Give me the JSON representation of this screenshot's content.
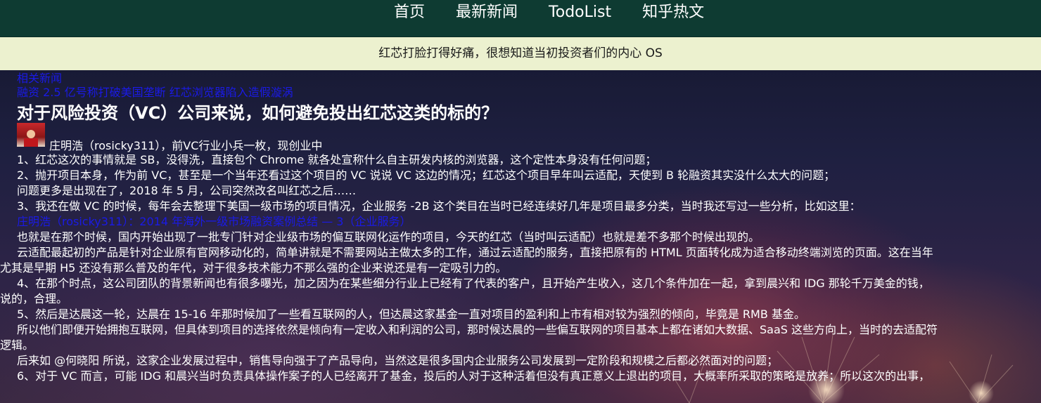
{
  "nav": {
    "items": [
      {
        "label": "首页"
      },
      {
        "label": "最新新闻"
      },
      {
        "label": "TodoList"
      },
      {
        "label": "知乎热文"
      }
    ]
  },
  "banner": {
    "text": "红芯打脸打得好痛，很想知道当初投资者们的内心 OS"
  },
  "related": {
    "header": "相关新闻",
    "link": "融资 2.5 亿号称打破美国垄断 红芯浏览器陷入造假漩涡"
  },
  "question": {
    "title": "对于风险投资（VC）公司来说，如何避免投出红芯这类的标的？"
  },
  "answer": {
    "author": "庄明浩（rosicky311），前VC行业小兵一枚，现创业中",
    "lines": [
      "1、红芯这次的事情就是 SB，没得洗，直接包个 Chrome 就各处宣称什么自主研发内核的浏览器，这个定性本身没有任何问题；",
      "2、抛开项目本身，作为前 VC，甚至是一个当年还看过这个项目的 VC 说说 VC 这边的情况；红芯这个项目早年叫云适配，天使到 B 轮融资其实没什么太大的问题；",
      "问题更多是出现在了，2018 年 5 月，公司突然改名叫红芯之后……",
      "3、我还在做 VC 的时候，每年会去整理下美国一级市场的项目情况，企业服务 -2B 这个类目在当时已经连续好几年是项目最多分类，当时我还写过一些分析，比如这里："
    ],
    "inline_link": "庄明浩（rosicky311）：2014 年海外一级市场融资案例总结 — 3（企业服务）",
    "lines2": [
      "  也就是在那个时候，国内开始出现了一批专门针对企业级市场的偏互联网化运作的项目，今天的红芯（当时叫云适配）也就是差不多那个时候出现的。",
      "  云适配最起初的产品是针对企业原有官网移动化的，简单讲就是不需要网站主做太多的工作，通过云适配的服务，直接把原有的 HTML 页面转化成为适合移动终端浏览的页面。这在当年",
      "尤其是早期 H5 还没有那么普及的年代，对于很多技术能力不那么强的企业来说还是有一定吸引力的。",
      "  4、在那个时点，这公司团队的背景新闻也有很多曝光，加之因为在某些细分行业上已经有了代表的客户，且开始产生收入，这几个条件加在一起，拿到晨兴和 IDG 那轮千万美金的钱，",
      "说的，合理。",
      "  5、然后是达晨这一轮，达晨在 15-16 年那时候加了一些看互联网的人，但达晨这家基金一直对项目的盈利和上市有相对较为强烈的倾向，毕竟是 RMB 基金。",
      "  所以他们即便开始拥抱互联网，但具体到项目的选择依然是倾向有一定收入和利润的公司，那时候达晨的一些偏互联网的项目基本上都在诸如大数据、SaaS 这些方向上，当时的去适配符",
      "逻辑。",
      "  后来如 @何晓阳 所说，这家企业发展过程中，销售导向强于了产品导向，当然这是很多国内企业服务公司发展到一定阶段和规模之后都必然面对的问题；",
      "  6、对于 VC 而言，可能 IDG 和晨兴当时负责具体操作案子的人已经离开了基金，投后的人对于这种活着但没有真正意义上退出的项目，大概率所采取的策略是放养；所以这次的出事，"
    ]
  },
  "colors": {
    "nav_bg": "#0e3b32",
    "banner_bg": "#ecf1cf",
    "link": "#1a1ae6",
    "text": "#ffffff"
  }
}
